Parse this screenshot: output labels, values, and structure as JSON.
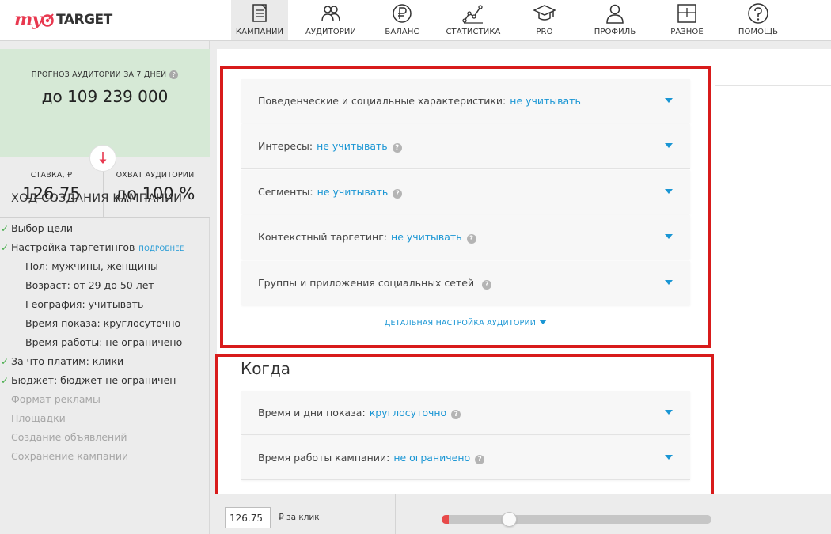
{
  "logo": {
    "my": "my",
    "target": "TARGET"
  },
  "nav": [
    {
      "label": "КАМПАНИИ",
      "icon": "campaigns-icon",
      "active": true
    },
    {
      "label": "АУДИТОРИИ",
      "icon": "audiences-icon"
    },
    {
      "label": "БАЛАНС",
      "icon": "ruble-icon"
    },
    {
      "label": "СТАТИСТИКА",
      "icon": "statistics-icon"
    },
    {
      "label": "PRO",
      "icon": "graduation-cap-icon"
    },
    {
      "label": "ПРОФИЛЬ",
      "icon": "profile-icon"
    },
    {
      "label": "РАЗНОЕ",
      "icon": "misc-icon"
    },
    {
      "label": "ПОМОЩЬ",
      "icon": "help-icon"
    }
  ],
  "forecast": {
    "title": "ПРОГНОЗ АУДИТОРИИ ЗА 7 ДНЕЙ",
    "help": "?",
    "value": "до 109 239 000"
  },
  "stats": {
    "bid_label": "СТАВКА, ₽",
    "bid_value": "126,75",
    "reach_label": "ОХВАТ АУДИТОРИИ",
    "reach_value": "до 100 %"
  },
  "progress": {
    "title": "ХОД СОЗДАНИЯ КАМПАНИИ",
    "more_link": "ПОДРОБНЕЕ",
    "steps": [
      {
        "text": "Выбор цели",
        "done": true
      },
      {
        "text": "Настройка таргетингов",
        "done": true
      },
      {
        "text": "Пол: мужчины, женщины"
      },
      {
        "text": "Возраст: от 29 до 50 лет"
      },
      {
        "text": "География: учитывать"
      },
      {
        "text": "Время показа: круглосуточно"
      },
      {
        "text": "Время работы: не ограничено"
      },
      {
        "text": "За что платим: клики",
        "done": true
      },
      {
        "text": "Бюджет: бюджет не ограничен",
        "done": true
      },
      {
        "text": "Формат рекламы"
      },
      {
        "text": "Площадки"
      },
      {
        "text": "Создание объявлений"
      },
      {
        "text": "Сохранение кампании"
      }
    ]
  },
  "targeting": [
    {
      "label": "Поведенческие и социальные характеристики:",
      "value": "не учитывать"
    },
    {
      "label": "Интересы:",
      "value": "не учитывать",
      "help": "?"
    },
    {
      "label": "Сегменты:",
      "value": "не учитывать",
      "help": "?"
    },
    {
      "label": "Контекстный таргетинг:",
      "value": "не учитывать",
      "help": "?"
    },
    {
      "label": "Группы и приложения социальных сетей",
      "help": "?"
    }
  ],
  "detail_link": "ДЕТАЛЬНАЯ НАСТРОЙКА АУДИТОРИИ",
  "when": {
    "title": "Когда",
    "rows": [
      {
        "label": "Время и дни показа:",
        "value": "круглосуточно",
        "help": "?"
      },
      {
        "label": "Время работы кампании:",
        "value": "не ограничено",
        "help": "?"
      }
    ]
  },
  "bottom": {
    "bid_value": "126.75",
    "bid_unit": "₽ за клик",
    "slider_fraction": 0.25
  },
  "colors": {
    "accent": "#1a96d4",
    "brand_red": "#e8384f",
    "highlight_box": "#d81b1b",
    "forecast_bg": "#d6e9d6",
    "check_green": "#4caf50"
  }
}
